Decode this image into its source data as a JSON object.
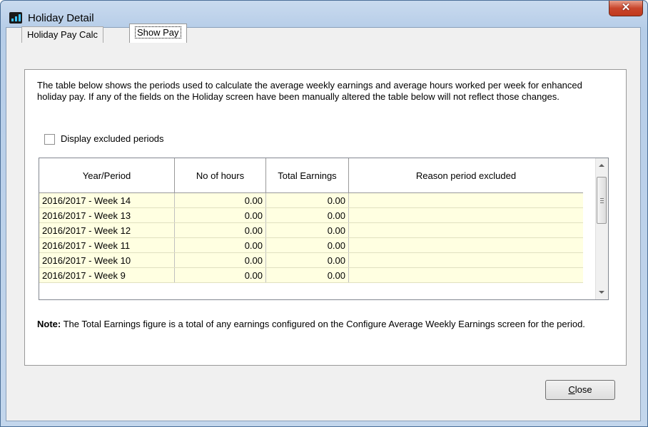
{
  "window": {
    "title": "Holiday Detail",
    "close_glyph": "✕",
    "icon": "app-icon"
  },
  "tabs": [
    {
      "label": "Holiday Pay Calc",
      "active": false
    },
    {
      "label": "Show Pay",
      "active": true
    }
  ],
  "description": "The table below shows the periods used to calculate the average weekly earnings and average hours worked per week for enhanced holiday pay. If any of the fields on the Holiday screen have been manually altered the table below will not reflect those changes.",
  "checkbox": {
    "label": "Display excluded periods",
    "checked": false
  },
  "grid": {
    "columns": [
      "Year/Period",
      "No of hours",
      "Total Earnings",
      "Reason period excluded"
    ],
    "rows": [
      [
        "2016/2017 - Week 14",
        "0.00",
        "0.00",
        ""
      ],
      [
        "2016/2017 - Week 13",
        "0.00",
        "0.00",
        ""
      ],
      [
        "2016/2017 - Week 12",
        "0.00",
        "0.00",
        ""
      ],
      [
        "2016/2017 - Week 11",
        "0.00",
        "0.00",
        ""
      ],
      [
        "2016/2017 - Week 10",
        "0.00",
        "0.00",
        ""
      ],
      [
        "2016/2017 - Week 9",
        "0.00",
        "0.00",
        ""
      ]
    ]
  },
  "note": {
    "bold": "Note:",
    "text": " The Total Earnings figure is a total of any earnings configured on the Configure Average Weekly Earnings screen for the period."
  },
  "buttons": {
    "close_first": "C",
    "close_rest": "lose"
  },
  "colors": {
    "row_background": "#ffffe1",
    "close_button_red": "#c9462c"
  }
}
